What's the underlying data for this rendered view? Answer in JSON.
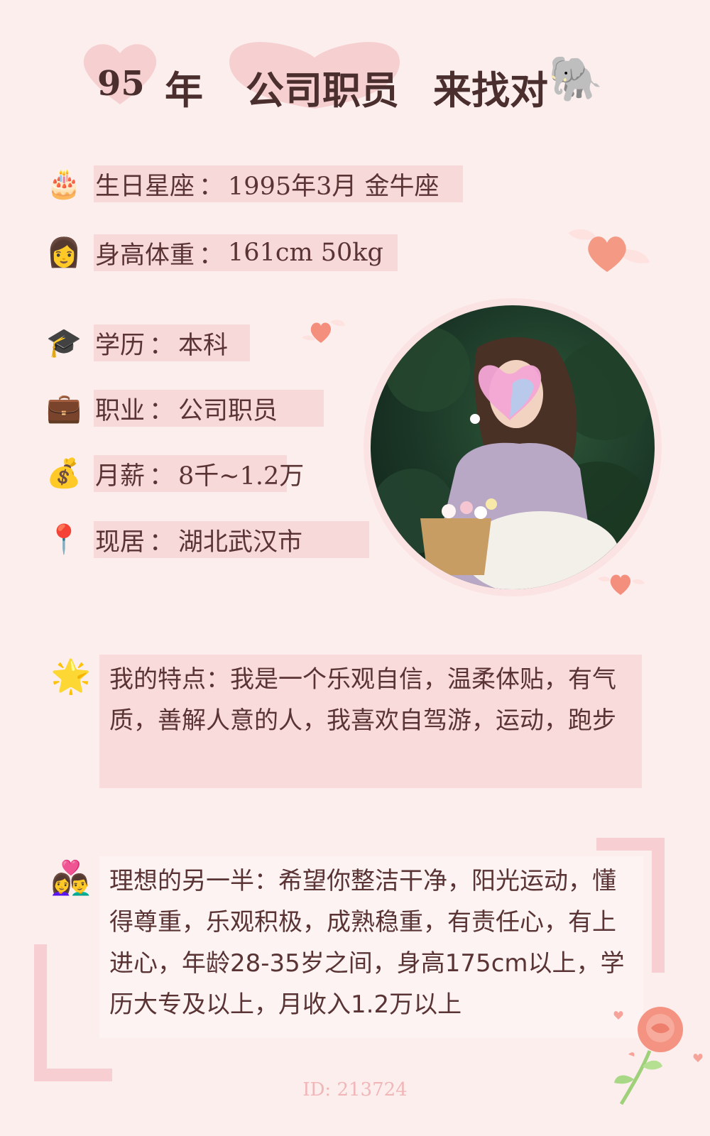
{
  "title": {
    "age": "95",
    "year_word": "年",
    "occupation": "公司职员",
    "seeking": "来找对",
    "seeking_icon": "elephant-icon"
  },
  "info": [
    {
      "icon": "birthday-cake-icon",
      "glyph": "🎂",
      "label": "生日星座",
      "value": "1995年3月 金牛座"
    },
    {
      "icon": "woman-icon",
      "glyph": "👩",
      "label": "身高体重",
      "value": "161cm 50kg"
    },
    {
      "icon": "graduation-cap-icon",
      "glyph": "🎓",
      "label": "学历",
      "value": "本科"
    },
    {
      "icon": "briefcase-icon",
      "glyph": "💼",
      "label": "职业",
      "value": "公司职员"
    },
    {
      "icon": "money-bag-icon",
      "glyph": "💰",
      "label": "月薪",
      "value": "8千~1.2万"
    },
    {
      "icon": "location-pin-icon",
      "glyph": "📍",
      "label": "现居",
      "value": "湖北武汉市"
    }
  ],
  "traits": {
    "icon": "star-icon",
    "glyph": "🌟",
    "label": "我的特点",
    "text": "我是一个乐观自信，温柔体贴，有气质，善解人意的人，我喜欢自驾游，运动，跑步"
  },
  "ideal": {
    "icon": "couple-heart-icon",
    "glyph": "👩‍❤️‍👨",
    "label": "理想的另一半",
    "text": "希望你整洁干净，阳光运动，懂得尊重，乐观积极，成熟稳重，有责任心，有上进心，年龄28-35岁之间，身高175cm以上，学历大专及以上，月收入1.2万以上"
  },
  "footer": {
    "id_text": "ID: 213724"
  },
  "colors": {
    "background": "#fdeeee",
    "bar": "#f8d9da",
    "heart_badge": "#f5c9ca",
    "accent_heart": "#f28a7a",
    "text": "#5a3434"
  }
}
